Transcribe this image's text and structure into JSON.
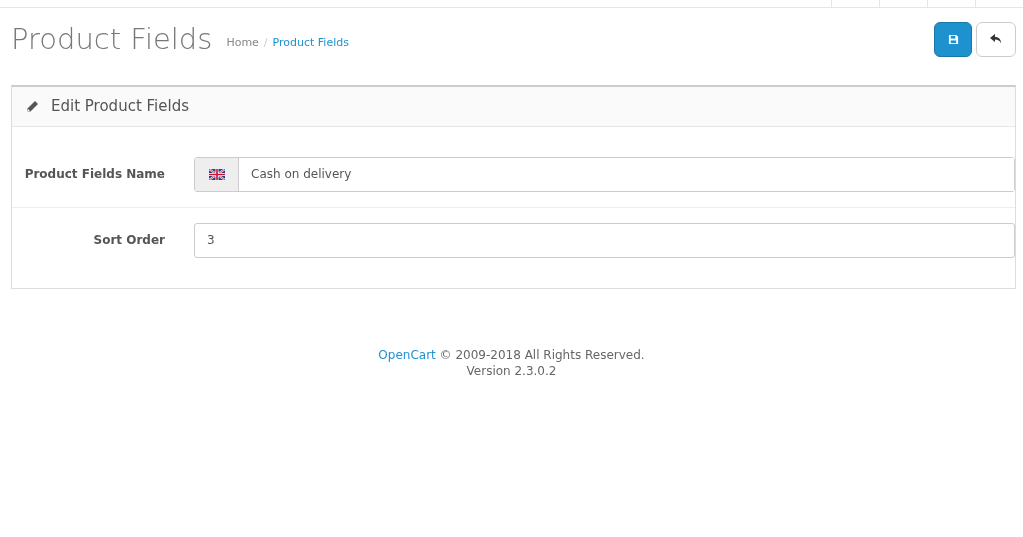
{
  "page_title": "Product Fields",
  "breadcrumb_separator": "/",
  "breadcrumb": [
    {
      "label": "Home",
      "selected": false
    },
    {
      "label": "Product Fields",
      "selected": true
    }
  ],
  "panel": {
    "title": "Edit Product Fields",
    "fields": [
      {
        "kind": "language",
        "label": "Product Fields Name",
        "value": "Cash on delivery"
      },
      {
        "kind": "plain",
        "label": "Sort Order",
        "value": "3"
      }
    ]
  },
  "footer": {
    "link": "OpenCart",
    "text": "© 2009-2018 All Rights Reserved.",
    "version": "Version 2.3.0.2"
  }
}
